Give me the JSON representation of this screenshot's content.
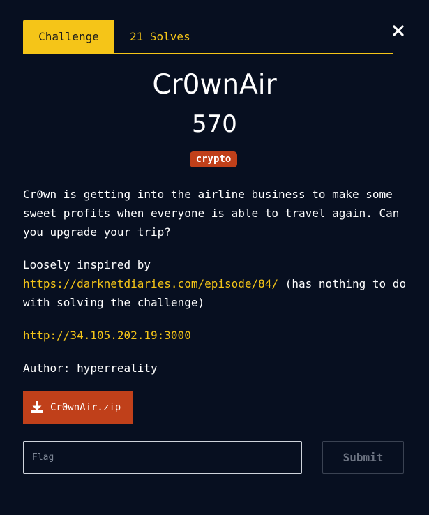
{
  "tabs": [
    {
      "label": "Challenge",
      "active": true
    },
    {
      "label": "21 Solves",
      "active": false
    }
  ],
  "challenge": {
    "name": "Cr0wnAir",
    "points": "570",
    "category": "crypto",
    "description": {
      "line1": "Cr0wn is getting into the airline business to make some sweet profits when everyone is able to travel again. Can you upgrade your trip?",
      "inspired_prefix": "Loosely inspired by ",
      "inspired_link": "https://darknetdiaries.com/episode/84/",
      "inspired_suffix": " (has nothing to do with solving the challenge)",
      "server_link": "http://34.105.202.19:3000",
      "author": "Author: hyperreality"
    },
    "file": "Cr0wnAir.zip"
  },
  "form": {
    "flag_placeholder": "Flag",
    "submit_label": "Submit"
  },
  "icons": {
    "close": "close-icon",
    "download": "download-icon"
  },
  "colors": {
    "background": "#070f20",
    "accent": "#f5c518",
    "tag": "#c0401a",
    "download_button": "#c0401a"
  }
}
